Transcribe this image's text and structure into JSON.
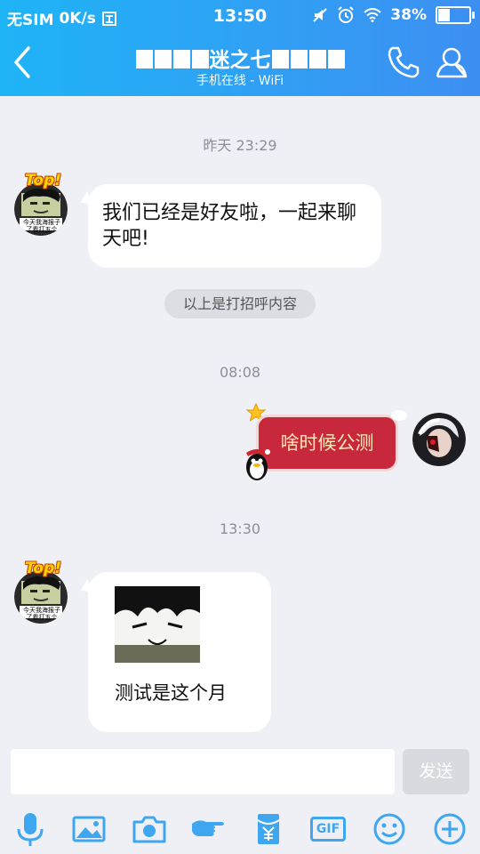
{
  "status_bar": {
    "carrier": "无SIM",
    "speed": "0K/s",
    "time": "13:50",
    "battery": "38%"
  },
  "header": {
    "title_text": "迷之七",
    "subtitle": "手机在线 - WiFi"
  },
  "messages": [
    {
      "type": "timestamp",
      "text": "昨天 23:29"
    },
    {
      "type": "incoming",
      "badge": "Top!",
      "avatar_caption": "今天我海报子 了看打五个",
      "text": "我们已经是好友啦，一起来聊天吧!"
    },
    {
      "type": "system",
      "text": "以上是打招呼内容"
    },
    {
      "type": "timestamp",
      "text": "08:08"
    },
    {
      "type": "outgoing",
      "text": "啥时候公测"
    },
    {
      "type": "timestamp",
      "text": "13:30"
    },
    {
      "type": "incoming",
      "badge": "Top!",
      "avatar_caption": "今天我海报子 了看打五个",
      "text": "测试是这个月"
    }
  ],
  "input": {
    "placeholder": "",
    "send_label": "发送"
  },
  "toolbar": {
    "gif_label": "GIF"
  },
  "colors": {
    "header_start": "#1fb4f6",
    "header_end": "#3d8ff2",
    "background": "#eef0f5",
    "outgoing_bubble": "#c8283c",
    "icon_blue": "#3fa6f0"
  }
}
